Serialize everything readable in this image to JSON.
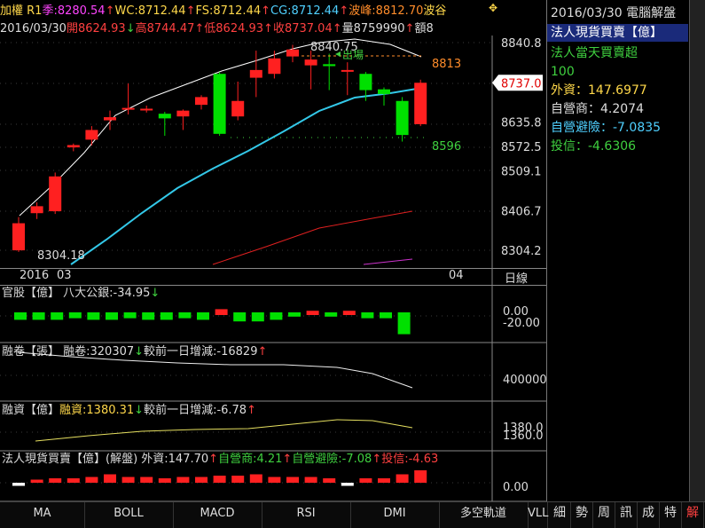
{
  "header": {
    "row1": [
      {
        "text": "加權 R1",
        "color": "#ffd84a"
      },
      {
        "text": "季:8280.54",
        "color": "#ff44ff"
      },
      {
        "text": "↑",
        "color": "#ff4040"
      },
      {
        "text": "WC:8712.44",
        "color": "#ffd84a"
      },
      {
        "text": "↑",
        "color": "#ff4040"
      },
      {
        "text": "FS:8712.44",
        "color": "#ffd84a"
      },
      {
        "text": "↑",
        "color": "#ff4040"
      },
      {
        "text": "CG:8712.44",
        "color": "#4fd0ff"
      },
      {
        "text": "↑",
        "color": "#ff4040"
      },
      {
        "text": "波峰:8812.70",
        "color": "#ff8c2a"
      },
      {
        "text": "波谷",
        "color": "#ffd84a"
      }
    ],
    "row2": [
      {
        "text": "2016/03/30",
        "color": "#dddddd"
      },
      {
        "text": "開8624.93",
        "color": "#ff4040"
      },
      {
        "text": "↓",
        "color": "#3fd03f"
      },
      {
        "text": "高8744.47",
        "color": "#ff4040"
      },
      {
        "text": "↑",
        "color": "#ff4040"
      },
      {
        "text": "低8624.93",
        "color": "#ff4040"
      },
      {
        "text": "↑",
        "color": "#ff4040"
      },
      {
        "text": "收8737.04",
        "color": "#ff4040"
      },
      {
        "text": "↑",
        "color": "#ff4040"
      },
      {
        "text": "量8759990",
        "color": "#dddddd"
      },
      {
        "text": "↑",
        "color": "#ff4040"
      },
      {
        "text": "額8",
        "color": "#dddddd"
      }
    ],
    "top_right_icon": "sparkle-icon"
  },
  "main_chart": {
    "y_ticks": [
      "8840.8",
      "8737.0",
      "8635.8",
      "8572.5",
      "8509.1",
      "8406.7",
      "8304.2"
    ],
    "current_price_box": "8737.0",
    "annotations": {
      "high_label": "8840.75",
      "low_label": "8304.18",
      "exit_label": "出場",
      "resistance": "8813",
      "support": "8596"
    },
    "x_labels": {
      "year": "2016",
      "month1": "03",
      "month2": "04",
      "period": "日線"
    }
  },
  "chart_data": {
    "type": "candlestick",
    "candles": [
      {
        "o": 8304,
        "c": 8374,
        "h": 8390,
        "l": 8300
      },
      {
        "o": 8400,
        "c": 8418,
        "h": 8428,
        "l": 8385
      },
      {
        "o": 8405,
        "c": 8495,
        "h": 8505,
        "l": 8398
      },
      {
        "o": 8570,
        "c": 8576,
        "h": 8580,
        "l": 8560
      },
      {
        "o": 8590,
        "c": 8615,
        "h": 8625,
        "l": 8575
      },
      {
        "o": 8640,
        "c": 8648,
        "h": 8665,
        "l": 8615
      },
      {
        "o": 8670,
        "c": 8672,
        "h": 8735,
        "l": 8655
      },
      {
        "o": 8668,
        "c": 8670,
        "h": 8678,
        "l": 8660
      },
      {
        "o": 8657,
        "c": 8645,
        "h": 8662,
        "l": 8600
      },
      {
        "o": 8650,
        "c": 8665,
        "h": 8668,
        "l": 8615
      },
      {
        "o": 8680,
        "c": 8700,
        "h": 8705,
        "l": 8668
      },
      {
        "o": 8760,
        "c": 8605,
        "h": 8765,
        "l": 8600
      },
      {
        "o": 8650,
        "c": 8690,
        "h": 8740,
        "l": 8640
      },
      {
        "o": 8750,
        "c": 8770,
        "h": 8820,
        "l": 8700
      },
      {
        "o": 8760,
        "c": 8800,
        "h": 8820,
        "l": 8748
      },
      {
        "o": 8805,
        "c": 8823,
        "h": 8835,
        "l": 8790
      },
      {
        "o": 8782,
        "c": 8797,
        "h": 8820,
        "l": 8720
      },
      {
        "o": 8785,
        "c": 8780,
        "h": 8812,
        "l": 8718
      },
      {
        "o": 8766,
        "c": 8770,
        "h": 8790,
        "l": 8705
      },
      {
        "o": 8760,
        "c": 8718,
        "h": 8765,
        "l": 8690
      },
      {
        "o": 8720,
        "c": 8708,
        "h": 8725,
        "l": 8678
      },
      {
        "o": 8690,
        "c": 8602,
        "h": 8700,
        "l": 8585
      },
      {
        "o": 8630,
        "c": 8737,
        "h": 8745,
        "l": 8625
      }
    ]
  },
  "panels": [
    {
      "id": "official",
      "title": [
        {
          "text": "官股【億】 八大公銀:-34.95",
          "color": "#dddddd"
        },
        {
          "text": "↓",
          "color": "#3fd03f"
        }
      ],
      "ticks": [
        "0.00",
        "-20.00"
      ]
    },
    {
      "id": "margin-short",
      "title": [
        {
          "text": "融卷【張】 融卷:320307",
          "color": "#dddddd"
        },
        {
          "text": "↓",
          "color": "#3fd03f"
        },
        {
          "text": "較前一日增減:-16829",
          "color": "#dddddd"
        },
        {
          "text": "↑",
          "color": "#ff4040"
        }
      ],
      "ticks": [
        "400000"
      ]
    },
    {
      "id": "margin-long",
      "title": [
        {
          "text": "融資【億】",
          "color": "#dddddd"
        },
        {
          "text": "融資:1380.31",
          "color": "#ffd84a"
        },
        {
          "text": "↓",
          "color": "#3fd03f"
        },
        {
          "text": "較前一日增減:-6.78",
          "color": "#dddddd"
        },
        {
          "text": "↑",
          "color": "#ff4040"
        }
      ],
      "ticks": [
        "1380.0",
        "1360.0"
      ]
    },
    {
      "id": "institutional",
      "title": [
        {
          "text": "法人現貨買賣【億】(解盤) 外資:147.70",
          "color": "#dddddd"
        },
        {
          "text": "↑",
          "color": "#ff4040"
        },
        {
          "text": "自營商:4.21",
          "color": "#3fd03f"
        },
        {
          "text": "↑",
          "color": "#ff4040"
        },
        {
          "text": "自營避險:-7.08",
          "color": "#3fd03f"
        },
        {
          "text": "↑",
          "color": "#ff4040"
        },
        {
          "text": "投信:-4.63",
          "color": "#ff4040"
        }
      ],
      "ticks": [
        "0.00"
      ]
    }
  ],
  "sidebar": {
    "date_title": "2016/03/30 電腦解盤",
    "selected_item": "法人現貨買賣【億】",
    "lines": [
      {
        "text": "法人當天買賣超",
        "color": "#3fd03f"
      },
      {
        "text": "100",
        "color": "#3fd03f"
      },
      {
        "text": "外資：147.6977",
        "color": "#ffd84a"
      },
      {
        "text": "自營商：4.2074",
        "color": "#dddddd"
      },
      {
        "text": "自營避險：-7.0835",
        "color": "#4fd0ff"
      },
      {
        "text": "投信：-4.6306",
        "color": "#3fd03f"
      }
    ]
  },
  "tabs": [
    {
      "label": "MA"
    },
    {
      "label": "BOLL"
    },
    {
      "label": "MACD"
    },
    {
      "label": "RSI"
    },
    {
      "label": "DMI"
    },
    {
      "label": "多空軌道"
    },
    {
      "label": "VLL"
    }
  ],
  "side_tabs": [
    "細",
    "勢",
    "周",
    "訊",
    "成",
    "特",
    "解"
  ],
  "colors": {
    "up": "#ff2020",
    "down": "#00e000",
    "ma1": "#ffffff",
    "ma2": "#33c8e8",
    "ma3": "#e02020",
    "ma4": "#cc33cc",
    "grid": "#3a3a3a"
  }
}
